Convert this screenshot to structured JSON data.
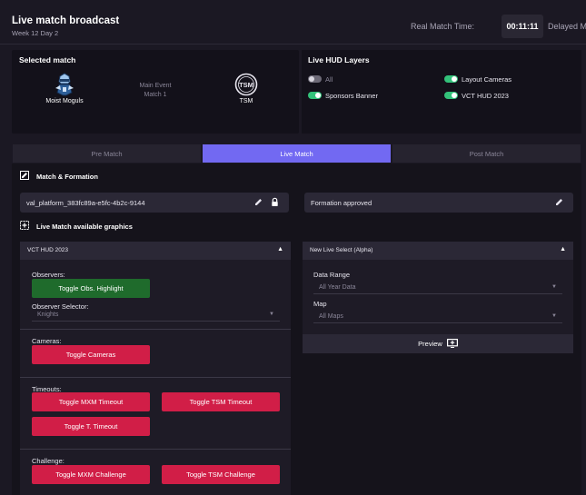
{
  "header": {
    "title": "Live match broadcast",
    "subtitle": "Week 12 Day 2",
    "real_time_label": "Real Match Time:",
    "real_time_value": "00:11:11",
    "delayed_label": "Delayed M"
  },
  "selected_match": {
    "title": "Selected match",
    "team1": {
      "name": "Moist Moguls",
      "logo": "moguls-mascot-logo"
    },
    "event": "Main Event",
    "match": "Match 1",
    "team2": {
      "name": "TSM",
      "logo": "tsm-logo",
      "logo_text": "TSM"
    }
  },
  "hud_layers": {
    "title": "Live HUD Layers",
    "items": [
      {
        "label": "All",
        "on": false
      },
      {
        "label": "Sponsors Banner",
        "on": true
      },
      {
        "label": "Layout Cameras",
        "on": true
      },
      {
        "label": "VCT HUD 2023",
        "on": true
      }
    ]
  },
  "tabs": [
    {
      "label": "Pre Match",
      "active": false
    },
    {
      "label": "Live Match",
      "active": true
    },
    {
      "label": "Post Match",
      "active": false
    }
  ],
  "match_formation": {
    "title": "Match & Formation",
    "platform_text": "val_platform_383fc89a-e5fc-4b2c-9144",
    "formation_text": "Formation approved"
  },
  "graphics": {
    "title": "Live Match available graphics",
    "vct_panel": {
      "title": "VCT HUD 2023",
      "observers_label": "Observers:",
      "toggle_obs": "Toggle Obs. Highlight",
      "observer_selector_label": "Observer Selector:",
      "observer_selector_value": "Knights",
      "cameras_label": "Cameras:",
      "toggle_cameras": "Toggle Cameras",
      "timeouts_label": "Timeouts:",
      "toggle_mxm_timeout": "Toggle MXM Timeout",
      "toggle_tsm_timeout": "Toggle TSM Timeout",
      "toggle_t_timeout": "Toggle T. Timeout",
      "challenge_label": "Challenge:",
      "toggle_mxm_challenge": "Toggle MXM Challenge",
      "toggle_tsm_challenge": "Toggle TSM Challenge"
    },
    "live_select_panel": {
      "title": "New Live Select (Alpha)",
      "data_range_label": "Data Range",
      "data_range_value": "All Year Data",
      "map_label": "Map",
      "map_value": "All Maps",
      "preview_label": "Preview"
    }
  },
  "colors": {
    "accent": "#7269f2",
    "danger": "#d11e47",
    "success": "#1f6b2c",
    "toggle_on": "#33c27a"
  }
}
